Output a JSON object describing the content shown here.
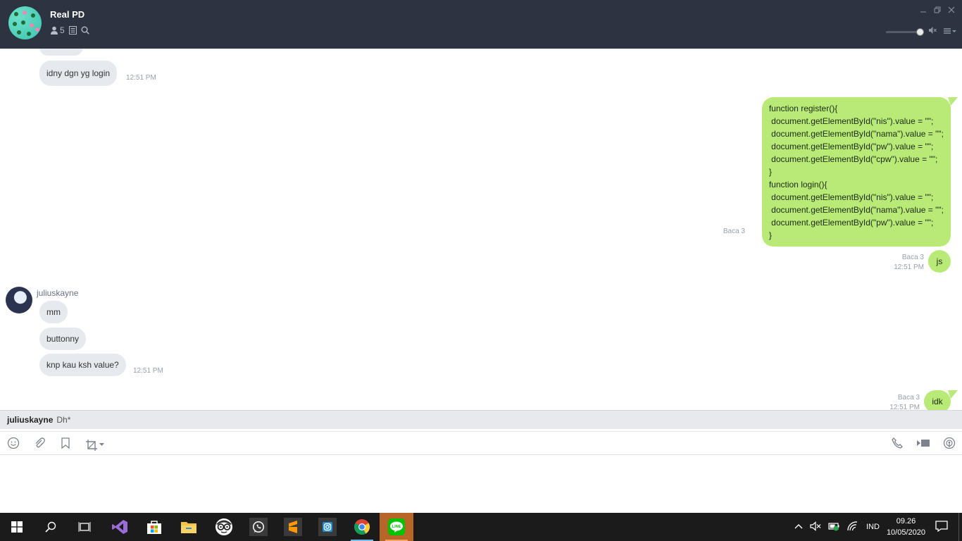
{
  "header": {
    "title": "Real PD",
    "member_count": "5"
  },
  "messages": {
    "in1": {
      "text": "idny dgn yg login",
      "time": "12:51 PM"
    },
    "out_code": {
      "read": "Baca 3",
      "lines": [
        "function register(){",
        " document.getElementById(\"nis\").value = \"\";",
        " document.getElementById(\"nama\").value = \"\";",
        " document.getElementById(\"pw\").value = \"\";",
        " document.getElementById(\"cpw\").value = \"\";",
        "}",
        "function login(){",
        " document.getElementById(\"nis\").value = \"\";",
        " document.getElementById(\"nama\").value = \"\";",
        " document.getElementById(\"pw\").value = \"\";",
        "}"
      ]
    },
    "out_js": {
      "text": "js",
      "read": "Baca 3",
      "time": "12:51 PM"
    },
    "sender": "juliuskayne",
    "in2": {
      "text": "mm"
    },
    "in3": {
      "text": "buttonny"
    },
    "in4": {
      "text": "knp kau ksh value?",
      "time": "12:51 PM"
    },
    "out_idk": {
      "text": "idk",
      "read": "Baca 3",
      "time": "12:51 PM"
    }
  },
  "notice": {
    "name": "juliuskayne",
    "message": "Dh*"
  },
  "taskbar": {
    "time": "09.26",
    "date": "10/05/2020",
    "lang": "IND"
  },
  "colors": {
    "header_bg": "#2d3340",
    "bubble_out": "#b9ea78",
    "bubble_in": "#e6e9ee"
  }
}
